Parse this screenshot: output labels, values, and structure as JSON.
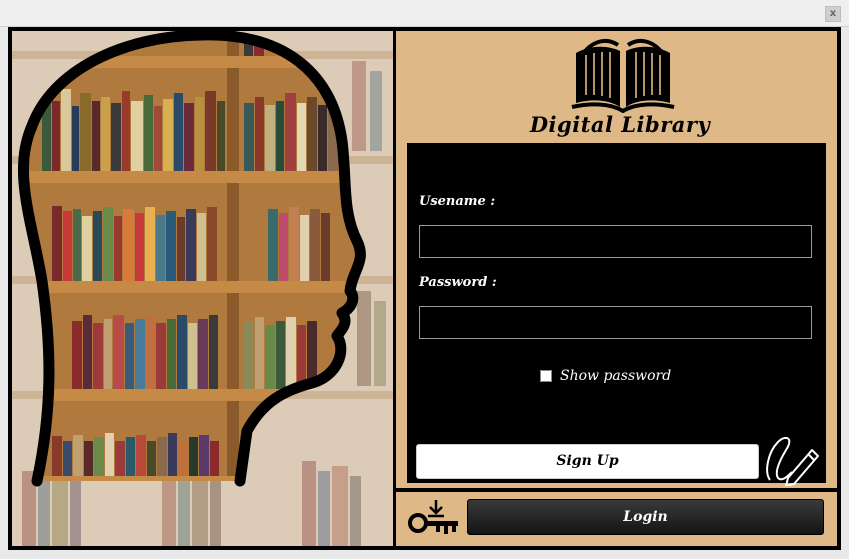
{
  "window": {
    "close_label": "x"
  },
  "app": {
    "title": "Digital Library"
  },
  "form": {
    "username_label": "Usename :",
    "username_value": "",
    "password_label": "Password :",
    "password_value": "",
    "show_password_label": "Show password",
    "show_password_checked": false
  },
  "buttons": {
    "signup_label": "Sign Up",
    "login_label": "Login"
  },
  "icons": {
    "logo": "open-book-icon",
    "signup_decoration": "pen-signature-icon",
    "login_decoration": "key-download-icon",
    "panel_image": "head-silhouette-bookshelf"
  },
  "colors": {
    "accent": "#deb887",
    "form_bg": "#000000",
    "frame": "#000000"
  }
}
